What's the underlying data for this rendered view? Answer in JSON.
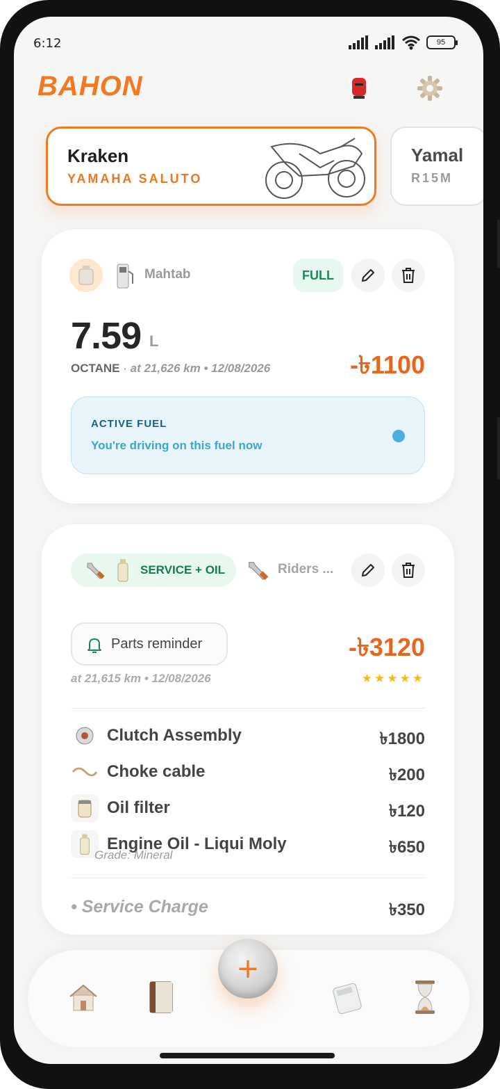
{
  "status": {
    "time": "6:12",
    "battery": "95"
  },
  "header": {
    "brand": "BAHON"
  },
  "vehicles": [
    {
      "name": "Kraken",
      "model": "YAMAHA SALUTO"
    },
    {
      "name": "Yamal",
      "model": "R15M"
    }
  ],
  "fuel_entry": {
    "station": "Mahtab",
    "fill_tag": "FULL",
    "litres": "7.59",
    "unit": "L",
    "fuel_type": "OCTANE",
    "meta": "at 21,626 km • 12/08/2026",
    "cost": "-৳1100",
    "active_title": "ACTIVE FUEL",
    "active_subtitle": "You're driving on this fuel now"
  },
  "service_entry": {
    "type_label": "SERVICE + OIL",
    "garage": "Riders ...",
    "reminder_label": "Parts reminder",
    "cost": "-৳3120",
    "meta": "at 21,615 km • 12/08/2026",
    "rating_text": "★★★★★",
    "rating": 5,
    "parts": [
      {
        "name": "Clutch Assembly",
        "price": "৳1800",
        "icon": "clutch-icon"
      },
      {
        "name": "Choke cable",
        "price": "৳200",
        "icon": "cable-icon"
      },
      {
        "name": "Oil filter",
        "price": "৳120",
        "icon": "oil-filter-icon"
      },
      {
        "name": "Engine Oil - Liqui Moly",
        "price": "৳650",
        "icon": "oil-bottle-icon"
      }
    ],
    "grade": "Grade: Mineral",
    "service_charge_label": "• Service Charge",
    "service_charge_price": "৳350"
  },
  "nav": {
    "items": [
      "home-icon",
      "logbook-icon",
      "add-icon",
      "calculator-icon",
      "hourglass-icon"
    ],
    "fab_symbol": "+"
  },
  "colors": {
    "accent": "#f07a22",
    "cost": "#e5661c",
    "success": "#1a8a57",
    "info": "#3ea5cc"
  }
}
